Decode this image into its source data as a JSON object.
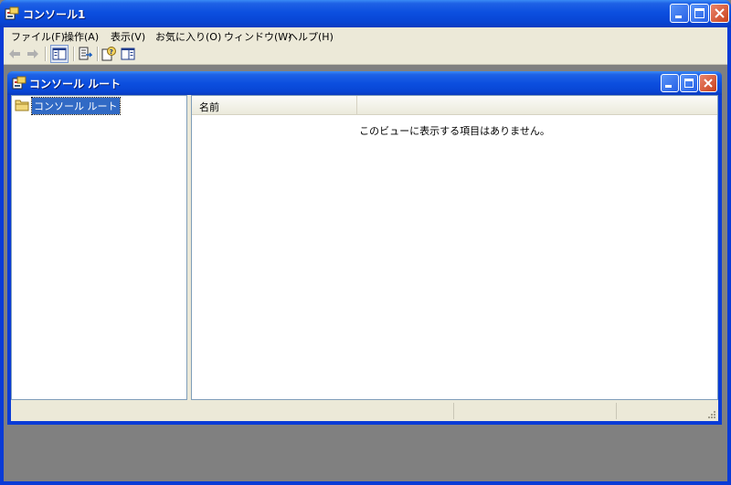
{
  "window": {
    "title": "コンソール1",
    "title_icon": "console-icon"
  },
  "menubar": {
    "items": [
      {
        "label": "ファイル(F)"
      },
      {
        "label": "操作(A)"
      },
      {
        "label": "表示(V)"
      },
      {
        "label": "お気に入り(O)"
      },
      {
        "label": "ウィンドウ(W)"
      },
      {
        "label": "ヘルプ(H)"
      }
    ]
  },
  "toolbar": {
    "buttons": [
      "back-arrow-icon",
      "forward-arrow-icon",
      "show-hide-tree-icon",
      "export-list-icon",
      "help-icon",
      "show-hide-action-pane-icon"
    ]
  },
  "child": {
    "title": "コンソール ルート",
    "tree_root_label": "コンソール ルート",
    "list_column_name": "名前",
    "empty_message": "このビューに表示する項目はありません。"
  },
  "colors": {
    "titlebar": "#0a3bd6",
    "selection": "#316ac5",
    "chrome": "#ece9d8",
    "close": "#c9421c"
  }
}
